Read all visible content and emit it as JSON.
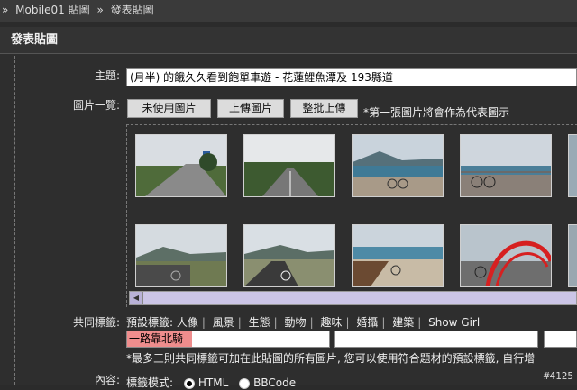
{
  "breadcrumb": [
    "»",
    "Mobile01 貼圖",
    "»",
    "發表貼圖"
  ],
  "panel": {
    "title": "發表貼圖"
  },
  "form": {
    "subject_label": "主題:",
    "subject_value": "(月半) 的餓久久看到飽單車遊 - 花蓮鯉魚潭及 193縣道",
    "images_label": "圖片一覽:",
    "buttons": [
      "未使用圖片",
      "上傳圖片",
      "整批上傳"
    ],
    "images_note": "*第一張圖片將會作為代表圖示",
    "tags_label": "共同標籤:",
    "preset_label": "預設標籤:",
    "preset_tags": [
      "人像",
      "風景",
      "生態",
      "動物",
      "趣味",
      "婚攝",
      "建築",
      "Show Girl"
    ],
    "tag_value": "一路靠北騎",
    "tags_hint": "*最多三則共同標籤可加在此貼圖的所有圖片, 您可以使用符合題材的預設標籤, 自行增",
    "content_label": "內容:",
    "markup_label": "標籤模式:",
    "markup_options": [
      "HTML",
      "BBCode"
    ]
  },
  "watermark": "#4125",
  "colors": {
    "background": "#2b2b2b",
    "highlight": "#ef8d8d",
    "scrollbar": "#cbc5e6"
  }
}
